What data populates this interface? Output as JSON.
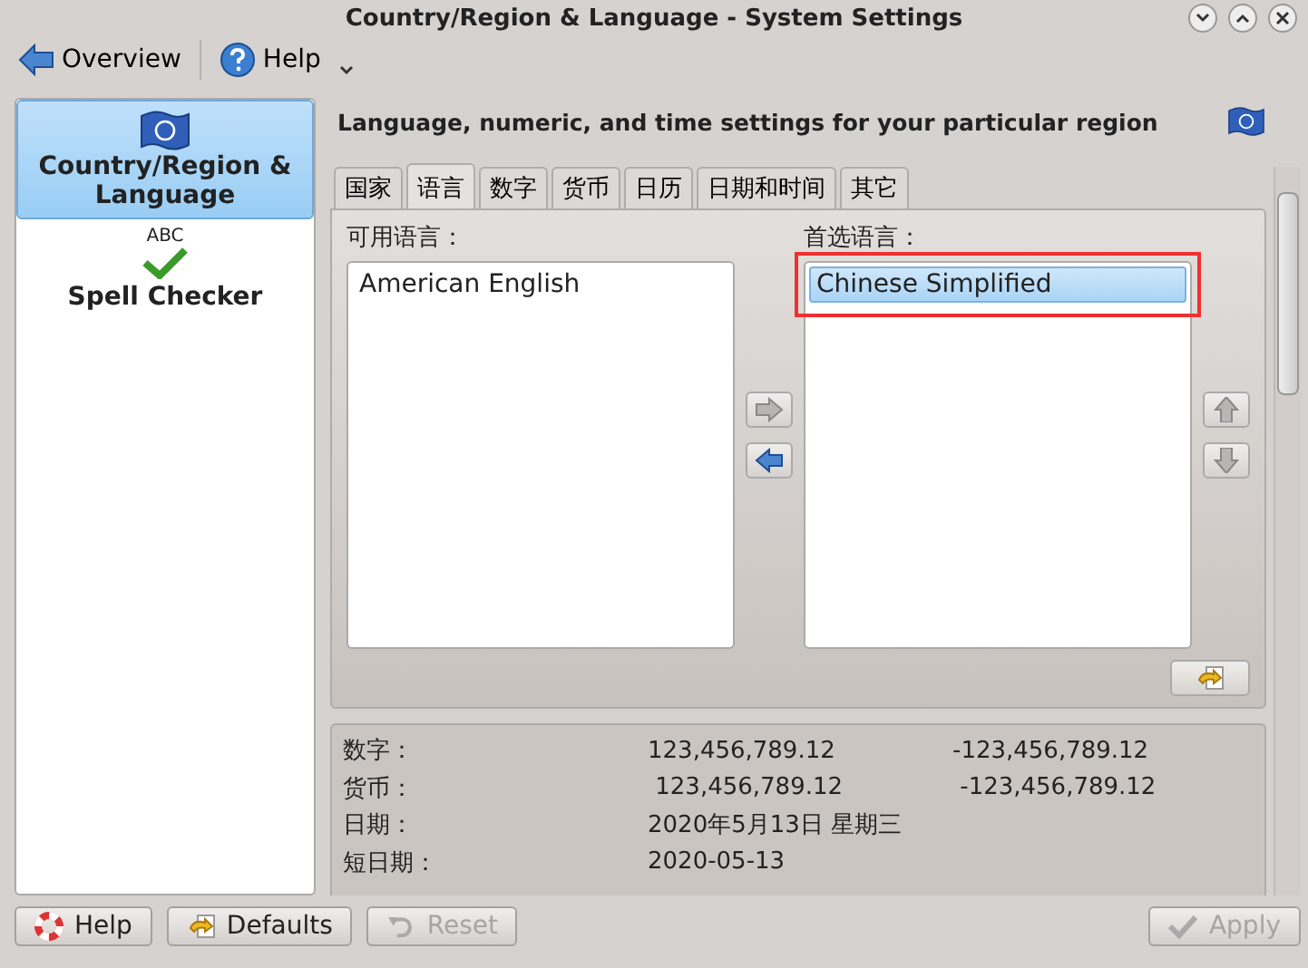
{
  "window": {
    "title": "Country/Region & Language - System Settings"
  },
  "toolbar": [
    {
      "label": "Overview",
      "kind": "back"
    },
    {
      "label": "Help",
      "kind": "help"
    }
  ],
  "sidebar": {
    "items": [
      {
        "label": "Country/Region & Language",
        "kind": "flag",
        "selected": true
      },
      {
        "label": "Spell Checker",
        "kind": "spell",
        "icon_text": "ABC",
        "selected": false
      }
    ]
  },
  "header": "Language, numeric, and time settings for your particular region",
  "tabs": [
    {
      "label": "国家",
      "selected": false
    },
    {
      "label": "语言",
      "selected": true
    },
    {
      "label": "数字",
      "selected": false
    },
    {
      "label": "货币",
      "selected": false
    },
    {
      "label": "日历",
      "selected": false
    },
    {
      "label": "日期和时间",
      "selected": false
    },
    {
      "label": "其它",
      "selected": false
    }
  ],
  "available": {
    "label": "可用语言：",
    "items": [
      {
        "label": "American English",
        "selected": false
      }
    ]
  },
  "preferred": {
    "label": "首选语言：",
    "items": [
      {
        "label": "Chinese Simplified",
        "selected": true
      }
    ]
  },
  "move_buttons": [
    {
      "kind": "right",
      "disabled": true
    },
    {
      "kind": "left",
      "disabled": false
    }
  ],
  "order_buttons": [
    {
      "kind": "up",
      "disabled": true
    },
    {
      "kind": "down",
      "disabled": true
    }
  ],
  "preview": [
    {
      "label": "数字：",
      "value": "123,456,789.12",
      "negative": "-123,456,789.12"
    },
    {
      "label": "货币：",
      "value": " 123,456,789.12",
      "negative": " -123,456,789.12"
    },
    {
      "label": "日期：",
      "value": "2020年5月13日 星期三"
    },
    {
      "label": "短日期：",
      "value": "2020-05-13"
    }
  ],
  "buttons": [
    {
      "label": "Help",
      "kind": "help",
      "disabled": false
    },
    {
      "label": "Defaults",
      "kind": "defaults",
      "disabled": false
    },
    {
      "label": "Reset",
      "kind": "reset",
      "disabled": true
    },
    {
      "label": "Apply",
      "kind": "apply",
      "disabled": true
    }
  ]
}
